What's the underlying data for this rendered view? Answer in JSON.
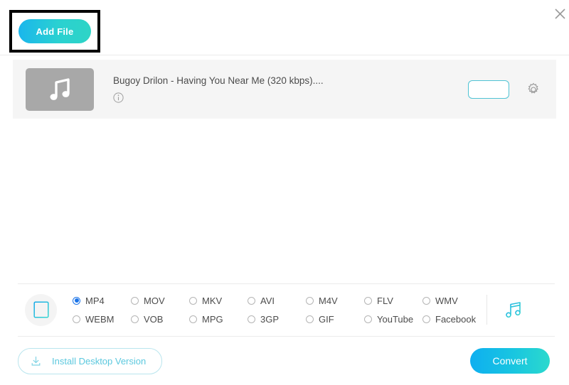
{
  "window": {
    "close_label": "×"
  },
  "header": {
    "add_file_label": "Add File"
  },
  "file_list": {
    "items": [
      {
        "name": "Bugoy Drilon - Having You Near Me (320 kbps)....",
        "format_value": "",
        "info_label": "i"
      }
    ]
  },
  "formats": {
    "media_type": "video",
    "selected": "MP4",
    "options": [
      "MP4",
      "MOV",
      "MKV",
      "AVI",
      "M4V",
      "FLV",
      "WMV",
      "WEBM",
      "VOB",
      "MPG",
      "3GP",
      "GIF",
      "YouTube",
      "Facebook"
    ]
  },
  "footer": {
    "install_label": "Install Desktop Version",
    "convert_label": "Convert"
  },
  "colors": {
    "accent_start": "#0eaff0",
    "accent_end": "#2bd9cd",
    "radio_selected": "#1a73e8",
    "outline_teal": "#4fc3d4",
    "install_text": "#5bc8de"
  }
}
